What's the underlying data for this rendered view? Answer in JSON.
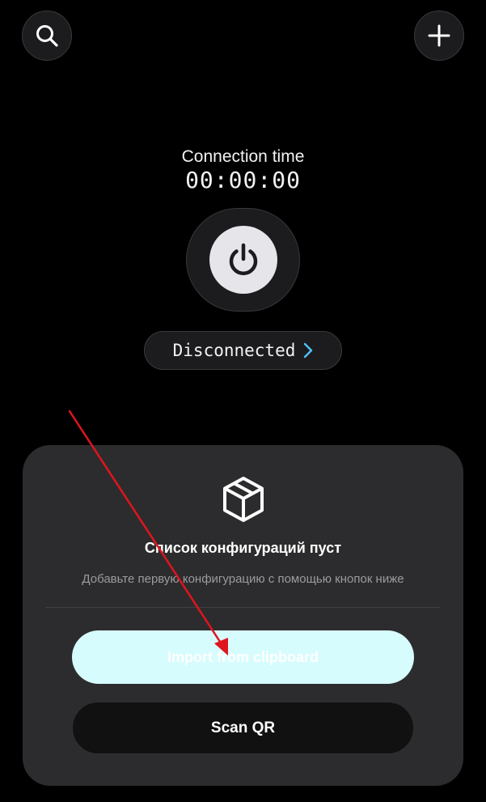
{
  "header": {
    "search_icon": "search-icon",
    "add_icon": "plus-icon"
  },
  "connection": {
    "label": "Connection time",
    "time": "00:00:00",
    "power_icon": "power-icon",
    "status": "Disconnected",
    "status_icon": "chevron-right-icon"
  },
  "empty_state": {
    "icon": "box-icon",
    "title": "Список конфигураций пуст",
    "subtitle": "Добавьте первую конфигурацию с помощью кнопок ниже",
    "import_label": "Import from clipboard",
    "scan_label": "Scan QR"
  },
  "colors": {
    "background": "#000000",
    "card": "#2c2c2e",
    "import_button": "#d7fcfd",
    "chevron": "#4fc3f7",
    "annotation_arrow": "#e0141e"
  }
}
